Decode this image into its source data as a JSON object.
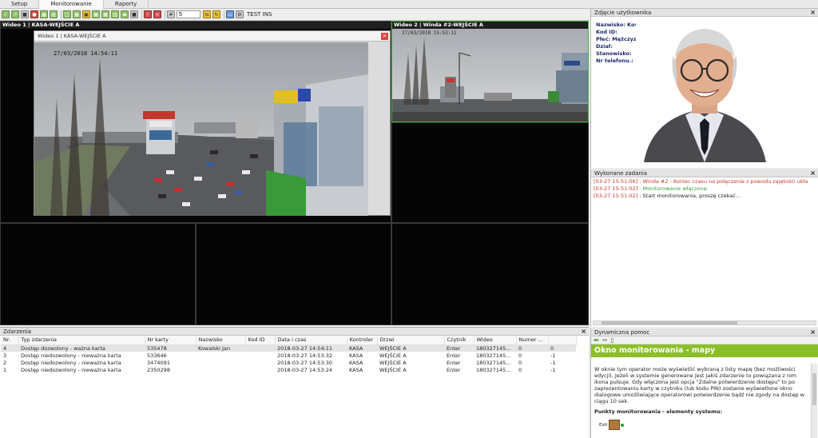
{
  "tabs": [
    {
      "label": "Setup"
    },
    {
      "label": "Monitorowanie"
    },
    {
      "label": "Raporty"
    }
  ],
  "toolbar": {
    "counter_value": "5",
    "test_label": "TEST INS"
  },
  "video": {
    "cell1_title": "Wideo 1 | KASA-WEJŚCIE A",
    "cell2_title": "Wideo 2 | Winda #2-WEJŚCIE A",
    "cell2_timestamp": "27/03/2018 15:53:11",
    "popup_title": "Wideo 1 | KASA-WEJŚCIE A",
    "popup_close": "×",
    "popup_overlay": "27/03/2018 14:54:11"
  },
  "events": {
    "title": "Zdarzenia",
    "close": "×",
    "columns": [
      "Nr.",
      "Typ zdarzenia",
      "Nr karty",
      "Nazwisko",
      "Kod ID",
      "Data i czas",
      "Kontroler",
      "Drzwi",
      "Czytnik",
      "Wideo",
      "Numer ...",
      ""
    ],
    "rows": [
      [
        "4",
        "Dostęp dozwolony - ważna karta",
        "535478",
        "Kowalski Jan",
        "",
        "2018-03-27 14:54:11",
        "KASA",
        "WEJŚCIE A",
        "Enter",
        "180327145...",
        "0",
        "0"
      ],
      [
        "3",
        "Dostęp niedozwolony - nieważna karta",
        "533646",
        "",
        "",
        "2018-03-27 14:53:32",
        "KASA",
        "WEJŚCIE A",
        "Enter",
        "180327145...",
        "0",
        "-1"
      ],
      [
        "2",
        "Dostęp niedozwolony - nieważna karta",
        "3474091",
        "",
        "",
        "2018-03-27 14:53:30",
        "KASA",
        "WEJŚCIE A",
        "Enter",
        "180327145...",
        "0",
        "-1"
      ],
      [
        "1",
        "Dostęp niedozwolony - nieważna karta",
        "2350298",
        "",
        "",
        "2018-03-27 14:53:24",
        "KASA",
        "WEJŚCIE A",
        "Enter",
        "180327145...",
        "0",
        "-1"
      ]
    ]
  },
  "photo_panel": {
    "title": "Zdjęcie użytkownika",
    "close": "×",
    "fields": [
      "Nazwisko: Kowalski Jan",
      "Kod ID:",
      "Płeć: Mężczyzna",
      "Dział:",
      "Stanowisko:",
      "Nr telefonu.:"
    ]
  },
  "tasks_panel": {
    "title": "Wykonane zadania",
    "close": "×",
    "lines": [
      {
        "time": "[03-27 15:51:06]",
        "text": " : Winda #2 - Koniec czasu na połączenie z powodu zajętości ukła",
        "kind": "err"
      },
      {
        "time": "[03-27 15:51:02]",
        "text": " : Monitorowanie włączone.",
        "kind": "ok"
      },
      {
        "time": "[03-27 15:51:02]",
        "text": " : Start monitorowania, proszę czekać...",
        "kind": "plain"
      }
    ]
  },
  "help_panel": {
    "title": "Dynamiczna pomoc",
    "close": "×",
    "heading": "Okno monitorowania - mapy",
    "body": "W oknie tym operator może wyświetlić wybraną z listy mapę (bez możliwości edycji). Jeżeli w systemie generowane jest jakiś zdarzenie to powiązana z nim ikona pulsuje. Gdy włączona jest opcja \"Zdalne potwierdzenie dostępu\" to po zaprezentowaniu karty w czytniku (lub kodu PIN) zostanie wyświetlone okno dialogowe umożliwiające operatorowi potwierdzenie bądź nie zgody na dostęp w ciągu 10 sek.",
    "subheading": "Punkty monitorowania - elementy systemu:",
    "exit_label": "Exit"
  },
  "colors": {
    "help_title_bg": "#8bbf2a",
    "error_text": "#c0392b",
    "ok_text": "#3a9a3a",
    "user_info_text": "#1a2a6a",
    "selected_video_border": "#3fae3f"
  }
}
